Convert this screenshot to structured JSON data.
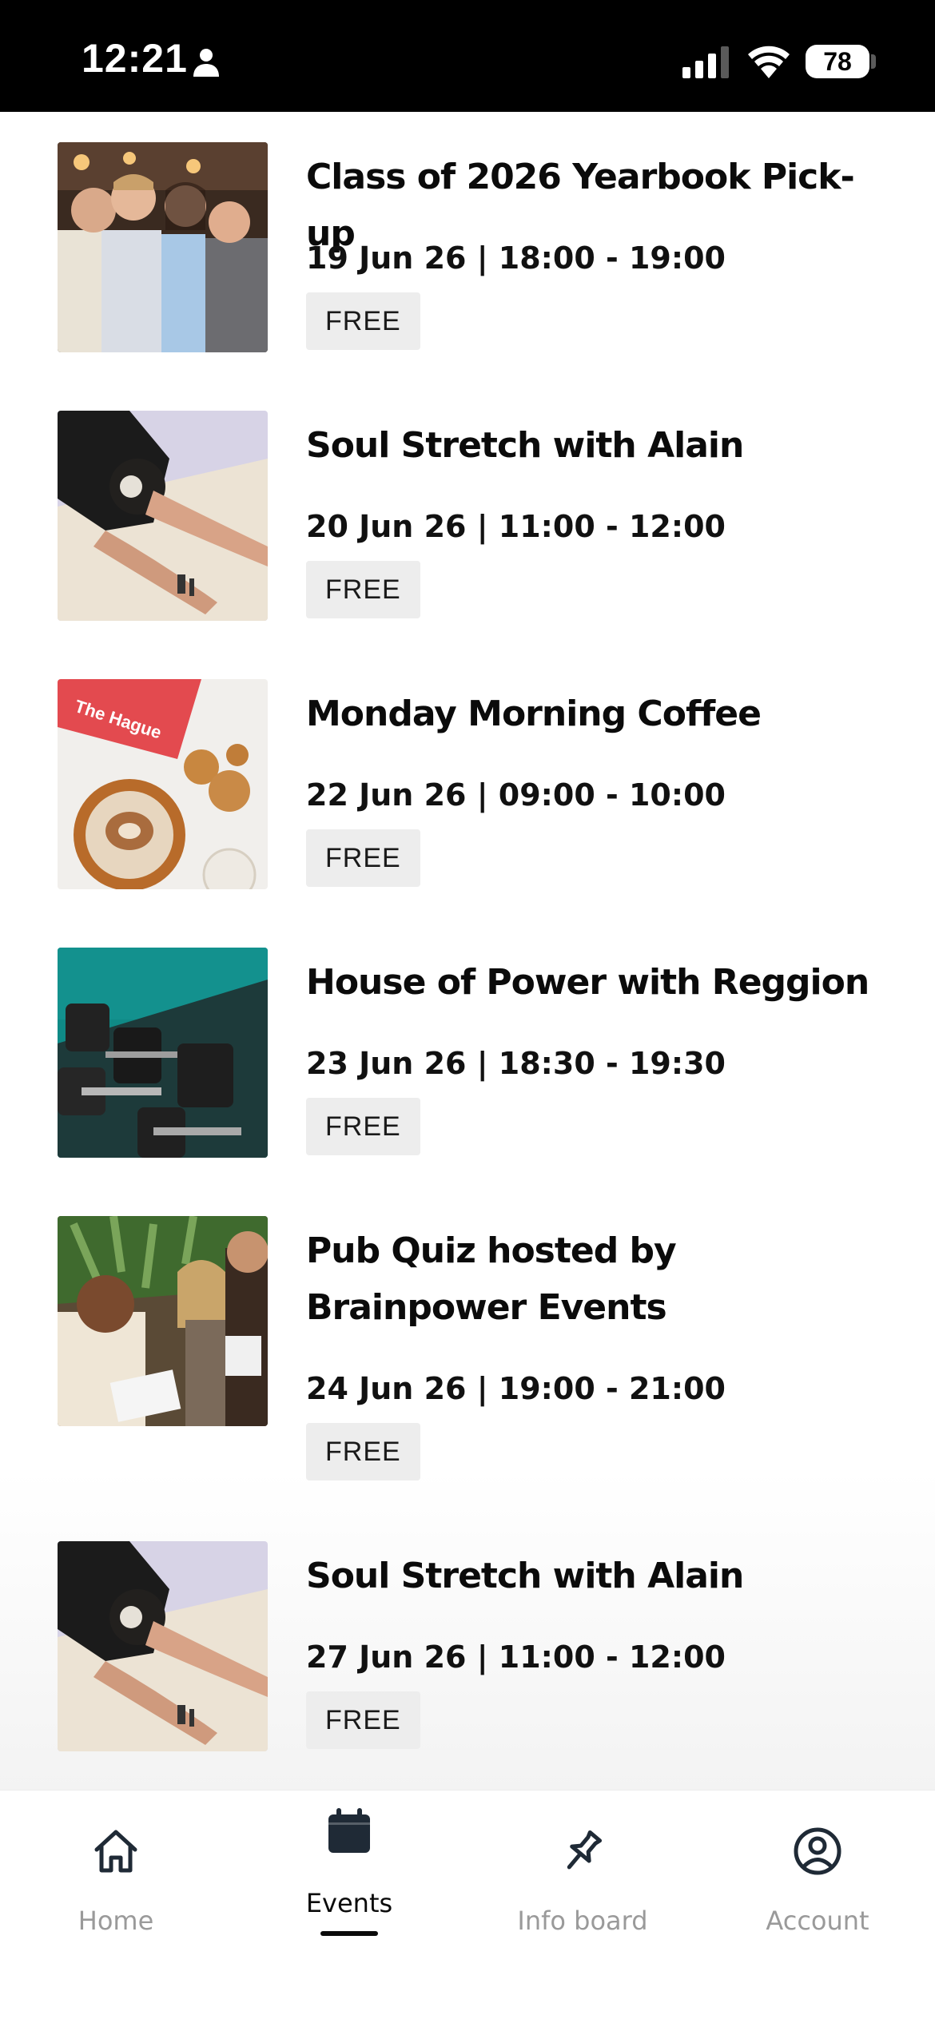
{
  "status_bar": {
    "time": "12:21",
    "battery": "78"
  },
  "events": [
    {
      "title": "Class of 2026 Yearbook Pick-up",
      "datetime": "19 Jun 26 | 18:00 - 19:00",
      "price": "FREE",
      "image": "group-photo"
    },
    {
      "title": "Soul Stretch with Alain",
      "datetime": "20 Jun 26 | 11:00 - 12:00",
      "price": "FREE",
      "image": "stretch-photo"
    },
    {
      "title": "Monday Morning Coffee",
      "datetime": "22 Jun 26 | 09:00 - 10:00",
      "price": "FREE",
      "image": "coffee-photo"
    },
    {
      "title": "House of Power with Reggion",
      "datetime": "23 Jun 26 | 18:30 - 19:30",
      "price": "FREE",
      "image": "dumbbells-photo"
    },
    {
      "title": "Pub Quiz hosted by Brainpower Events",
      "datetime": "24 Jun 26 | 19:00 - 21:00",
      "price": "FREE",
      "image": "pub-quiz-photo"
    },
    {
      "title": "Soul Stretch with Alain",
      "datetime": "27 Jun 26 | 11:00 - 12:00",
      "price": "FREE",
      "image": "stretch-photo"
    }
  ],
  "coffee_photo_text": "The Hague",
  "tabs": [
    {
      "label": "Home",
      "icon": "home-icon",
      "active": false
    },
    {
      "label": "Events",
      "icon": "calendar-icon",
      "active": true
    },
    {
      "label": "Info board",
      "icon": "pin-icon",
      "active": false
    },
    {
      "label": "Account",
      "icon": "account-icon",
      "active": false
    }
  ],
  "colors": {
    "primary": "#0b0b0b",
    "inactive_tab": "#9a9a9a",
    "tag_background": "#ededed"
  }
}
